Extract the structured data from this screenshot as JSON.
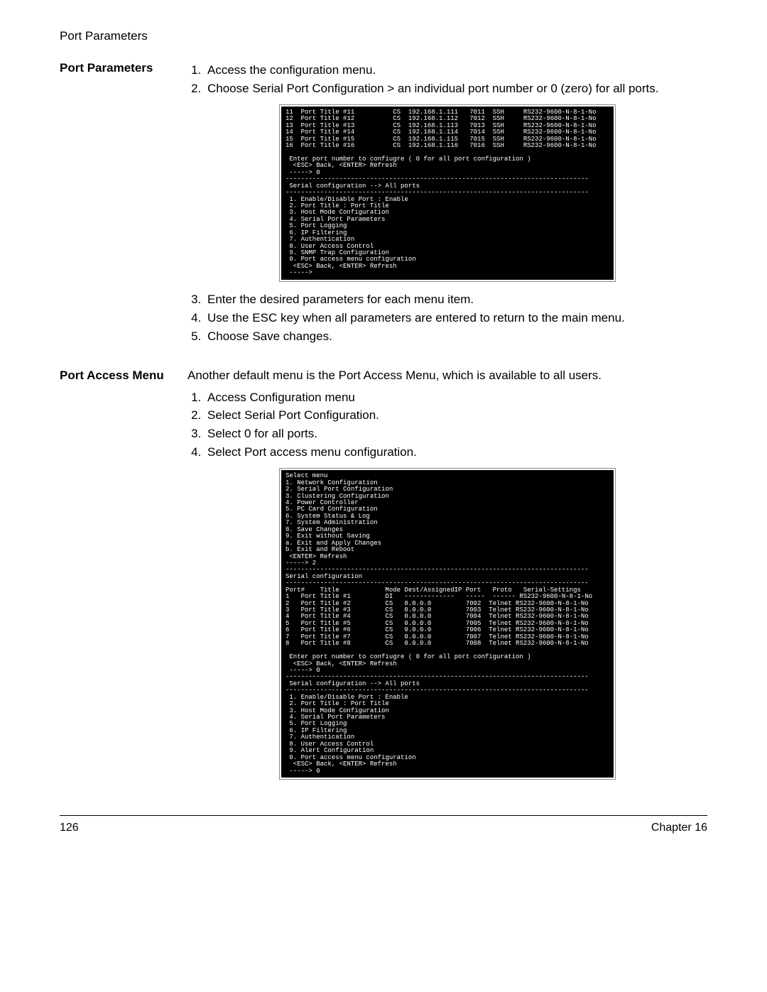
{
  "running_head": "Port Parameters",
  "section1": {
    "title": "Port Parameters",
    "steps_a": [
      "Access the configuration menu.",
      "Choose Serial Port Configuration > an individual port number or 0 (zero) for all ports."
    ],
    "steps_b": [
      "Enter the desired parameters for each menu item.",
      "Use the ESC key when all parameters are entered to return to the main menu.",
      "Choose Save changes."
    ]
  },
  "section2": {
    "title": "Port Access Menu",
    "intro": "Another default menu is the Port Access Menu, which is available to all users.",
    "steps": [
      "Access Configuration menu",
      "Select Serial Port Configuration.",
      "Select 0 for all ports.",
      "Select Port access menu configuration."
    ]
  },
  "terminal1": "11  Port Title #11          CS  192.168.1.111   7011  SSH     RS232-9600-N-8-1-No\n12  Port Title #12          CS  192.168.1.112   7012  SSH     RS232-9600-N-8-1-No\n13  Port Title #13          CS  192.168.1.113   7013  SSH     RS232-9600-N-8-1-No\n14  Port Title #14          CS  192.168.1.114   7014  SSH     RS232-9600-N-8-1-No\n15  Port Title #15          CS  192.168.1.115   7015  SSH     RS232-9600-N-8-1-No\n16  Port Title #16          CS  192.168.1.116   7016  SSH     RS232-9600-N-8-1-No\n\n Enter port number to confiugre ( 0 for all port configuration )\n  <ESC> Back, <ENTER> Refresh\n -----> 0\n-------------------------------------------------------------------------------\n Serial configuration --> All ports\n-------------------------------------------------------------------------------\n 1. Enable/Disable Port : Enable\n 2. Port Title : Port Title\n 3. Host Mode Configuration\n 4. Serial Port Parameters\n 5. Port Logging\n 6. IP Filtering\n 7. Authentication\n 8. User Access Control\n 9. SNMP Trap Configuration\n 0. Port access menu configuration\n  <ESC> Back, <ENTER> Refresh\n ----->",
  "terminal2": "Select menu\n1. Network Configuration\n2. Serial Port Configuration\n3. Clustering Configuration\n4. Power Controller\n5. PC Card Configuration\n6. System Status & Log\n7. System Administration\n8. Save Changes\n9. Exit without Saving\na. Exit and Apply Changes\nb. Exit and Reboot\n <ENTER> Refresh\n-----> 2\n-------------------------------------------------------------------------------\nSerial configuration\n-------------------------------------------------------------------------------\nPort#    Title            Mode Dest/AssignedIP Port   Proto   Serial-Settings\n1   Port Title #1         DI   -------------   -----  ------ RS232-9600-N-8-1-No\n2   Port Title #2         CS   0.0.0.0         7002  Telnet RS232-9600-N-8-1-No\n3   Port Title #3         CS   0.0.0.0         7003  Telnet RS232-9600-N-8-1-No\n4   Port Title #4         CS   0.0.0.0         7004  Telnet RS232-9600-N-8-1-No\n5   Port Title #5         CS   0.0.0.0         7005  Telnet RS232-9600-N-8-1-No\n6   Port Title #6         CS   0.0.0.0         7006  Telnet RS232-9600-N-8-1-No\n7   Port Title #7         CS   0.0.0.0         7007  Telnet RS232-9600-N-8-1-No\n8   Port Title #8         CS   0.0.0.0         7008  Telnet RS232-9600-N-8-1-No\n\n Enter port number to confiugre ( 0 for all port configuration )\n  <ESC> Back, <ENTER> Refresh\n -----> 0\n-------------------------------------------------------------------------------\n Serial configuration --> All ports\n-------------------------------------------------------------------------------\n 1. Enable/Disable Port : Enable\n 2. Port Title : Port Title\n 3. Host Mode Configuration\n 4. Serial Port Parameters\n 5. Port Logging\n 6. IP Filtering\n 7. Authentication\n 8. User Access Control\n 9. Alert Configuration\n 0. Port access menu configuration\n  <ESC> Back, <ENTER> Refresh\n -----> 0",
  "footer": {
    "page": "126",
    "chapter": "Chapter 16"
  }
}
